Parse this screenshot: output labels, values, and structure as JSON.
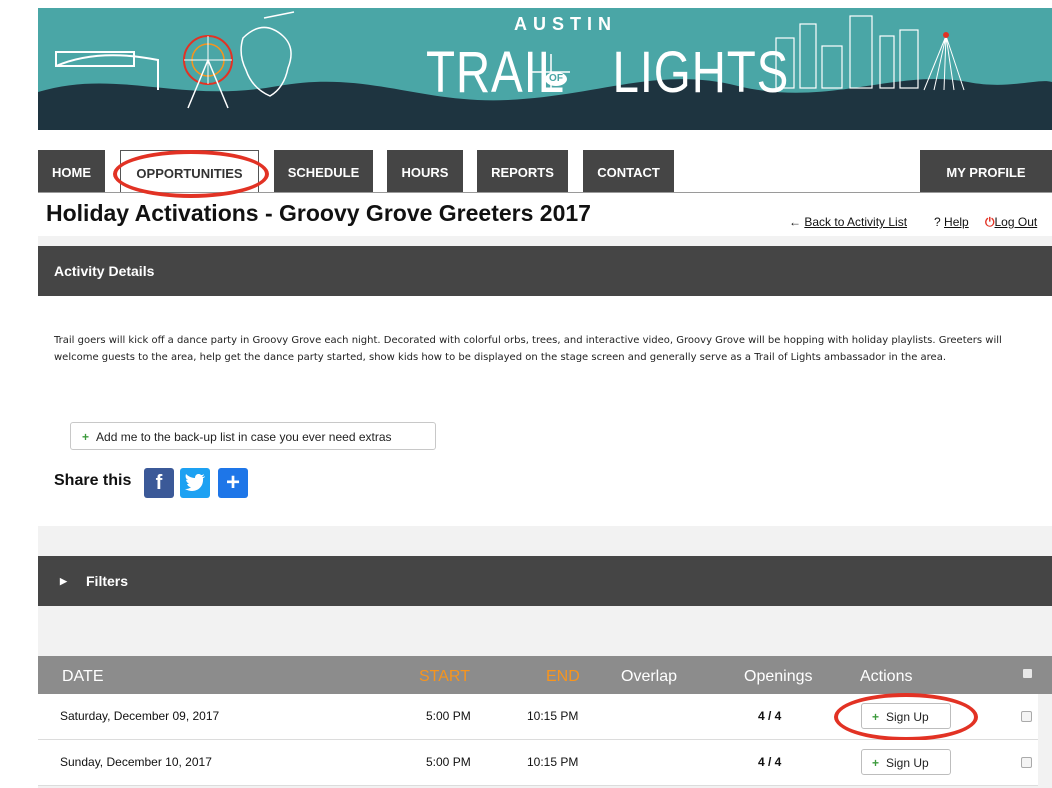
{
  "banner": {
    "austin": "AUSTIN",
    "title_left": "TRAIL",
    "title_of": "OF",
    "title_right": "LIGHTS",
    "sign_text": "TRAIL of LIGHTS"
  },
  "nav": {
    "home": "HOME",
    "opportunities": "OPPORTUNITIES",
    "schedule": "SCHEDULE",
    "hours": "HOURS",
    "reports": "REPORTS",
    "contact": "CONTACT",
    "my_profile": "MY PROFILE"
  },
  "page_title": "Holiday Activations - Groovy Grove Greeters 2017",
  "links": {
    "back": "Back to Activity List",
    "back_icon": "←",
    "help": "Help",
    "help_icon": "?",
    "logout": "Log Out",
    "logout_icon": "power-icon"
  },
  "activity_details": {
    "header": "Activity Details",
    "description": "Trail goers will kick off a dance party in Groovy Grove each night. Decorated with colorful orbs, trees, and interactive video, Groovy Grove will be hopping with holiday playlists. Greeters will welcome guests to the area, help get the dance party started, show kids how to be displayed on the stage screen and generally serve as a Trail of Lights ambassador in the area.",
    "backup_button": "Add me to the back-up list in case you ever need extras",
    "share_label": "Share this"
  },
  "filters": {
    "label": "Filters"
  },
  "table": {
    "headers": {
      "date": "DATE",
      "start": "START",
      "end": "END",
      "overlap": "Overlap",
      "openings": "Openings",
      "actions": "Actions"
    },
    "rows": [
      {
        "date": "Saturday, December 09, 2017",
        "start": "5:00 PM",
        "end": "10:15 PM",
        "openings": "4 / 4",
        "action": "Sign Up"
      },
      {
        "date": "Sunday, December 10, 2017",
        "start": "5:00 PM",
        "end": "10:15 PM",
        "openings": "4 / 4",
        "action": "Sign Up"
      }
    ]
  },
  "colors": {
    "banner_teal": "#4aa6a6",
    "banner_dark": "#1e3440",
    "nav_dark": "#454545",
    "header_orange": "#f7941d",
    "highlight_red": "#e23224",
    "plus_green": "#3d9b3d"
  },
  "icons": [
    "facebook-icon",
    "twitter-icon",
    "addthis-icon",
    "power-icon",
    "plus-icon",
    "caret-right-icon"
  ]
}
